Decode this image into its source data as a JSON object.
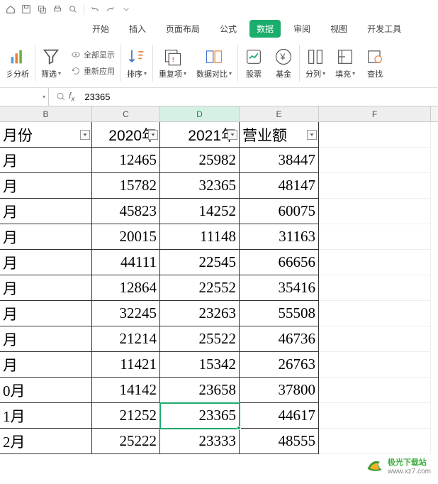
{
  "tabs": {
    "start": "开始",
    "insert": "插入",
    "layout": "页面布局",
    "formula": "公式",
    "data": "数据",
    "review": "审阅",
    "view": "视图",
    "dev": "开发工具"
  },
  "ribbon": {
    "analysis": "彡分析",
    "filter": "筛选",
    "show_all": "全部显示",
    "reapply": "重新应用",
    "sort": "排序",
    "dedup": "重复项",
    "compare": "数据对比",
    "stock": "股票",
    "fund": "基金",
    "split": "分列",
    "fill": "填充",
    "find": "查找"
  },
  "formula_bar": {
    "value": "23365"
  },
  "columns": {
    "b": "B",
    "c": "C",
    "d": "D",
    "e": "E",
    "f": "F"
  },
  "header_row": {
    "b": "月份",
    "c": "2020年",
    "d": "2021年",
    "e": "营业额"
  },
  "rows": [
    {
      "b": "月",
      "c": "12465",
      "d": "25982",
      "e": "38447"
    },
    {
      "b": "月",
      "c": "15782",
      "d": "32365",
      "e": "48147"
    },
    {
      "b": "月",
      "c": "45823",
      "d": "14252",
      "e": "60075"
    },
    {
      "b": "月",
      "c": "20015",
      "d": "11148",
      "e": "31163"
    },
    {
      "b": "月",
      "c": "44111",
      "d": "22545",
      "e": "66656"
    },
    {
      "b": "月",
      "c": "12864",
      "d": "22552",
      "e": "35416"
    },
    {
      "b": "月",
      "c": "32245",
      "d": "23263",
      "e": "55508"
    },
    {
      "b": "月",
      "c": "21214",
      "d": "25522",
      "e": "46736"
    },
    {
      "b": "月",
      "c": "11421",
      "d": "15342",
      "e": "26763"
    },
    {
      "b": "0月",
      "c": "14142",
      "d": "23658",
      "e": "37800"
    },
    {
      "b": "1月",
      "c": "21252",
      "d": "23365",
      "e": "44617"
    },
    {
      "b": "2月",
      "c": "25222",
      "d": "23333",
      "e": "48555"
    }
  ],
  "watermark": {
    "main": "极光下载站",
    "url": "www.xz7.com"
  }
}
